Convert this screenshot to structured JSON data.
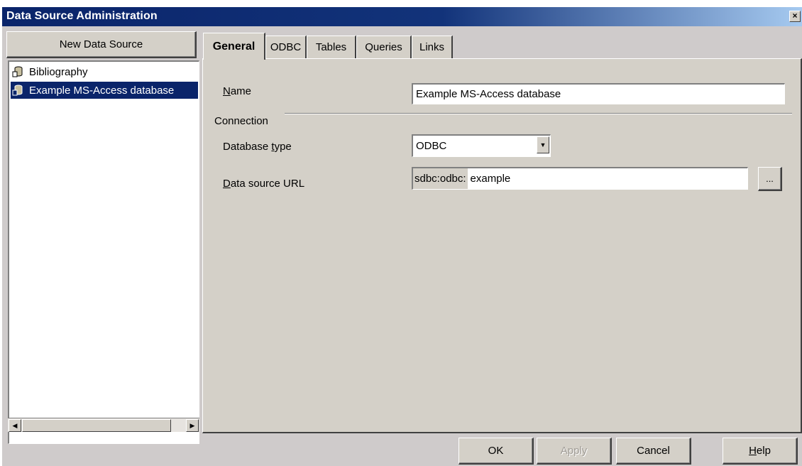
{
  "window": {
    "title": "Data Source Administration",
    "close_glyph": "×"
  },
  "sidebar": {
    "new_button_label": "New Data Source",
    "items": [
      {
        "label": "Bibliography",
        "icon": "database-icon",
        "selected": false
      },
      {
        "label": "Example MS-Access database",
        "icon": "database-icon",
        "selected": true
      }
    ],
    "scroll_left_glyph": "◀",
    "scroll_right_glyph": "▶"
  },
  "tabs": [
    {
      "label": "General",
      "active": true
    },
    {
      "label": "ODBC",
      "active": false
    },
    {
      "label": "Tables",
      "active": false
    },
    {
      "label": "Queries",
      "active": false
    },
    {
      "label": "Links",
      "active": false
    }
  ],
  "general": {
    "name_label_accel": "N",
    "name_label_rest": "ame",
    "name_value": "Example MS-Access database",
    "connection_label": "Connection",
    "dbtype_label_pre": "Database ",
    "dbtype_label_accel": "t",
    "dbtype_label_post": "ype",
    "dbtype_value": "ODBC",
    "dbtype_arrow_glyph": "▼",
    "url_label_accel": "D",
    "url_label_rest": "ata source URL",
    "url_prefix": "sdbc:odbc:",
    "url_value": "example",
    "browse_label": "..."
  },
  "buttons": {
    "ok": "OK",
    "apply": "Apply",
    "cancel": "Cancel",
    "help_accel": "H",
    "help_rest": "elp"
  },
  "colors": {
    "title_bar": "#0a246a",
    "selection": "#0a246a",
    "dialog_face": "#d4d0c8"
  }
}
